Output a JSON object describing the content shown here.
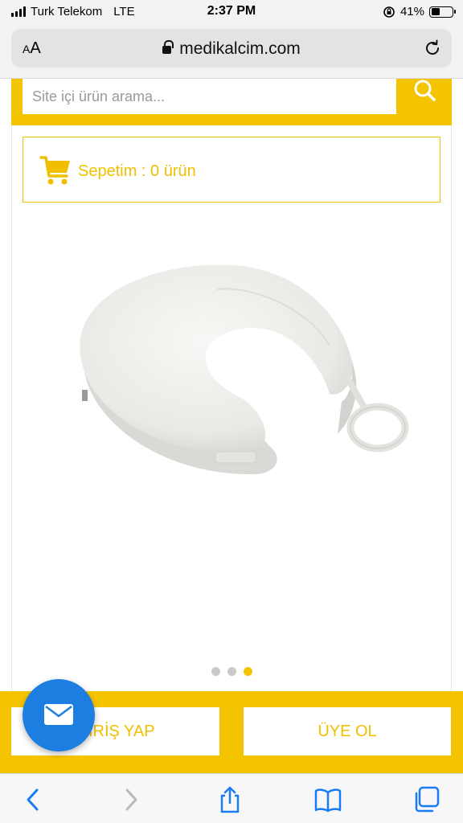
{
  "status_bar": {
    "carrier": "Turk Telekom",
    "network": "LTE",
    "time": "2:37 PM",
    "battery": "41%",
    "battery_level": 0.41
  },
  "browser": {
    "text_size_label": "AA",
    "url": "medikalcim.com"
  },
  "search": {
    "placeholder": "Site içi ürün arama..."
  },
  "cart": {
    "label": "Sepetim : 0 ürün"
  },
  "carousel": {
    "slide_count": 3,
    "active_index": 2
  },
  "actions": {
    "login_label": "GİRİŞ YAP",
    "register_label": "ÜYE OL"
  },
  "colors": {
    "brand_yellow": "#f5c400",
    "mail_blue": "#1c7ee0"
  },
  "icons": {
    "search": "search-icon",
    "cart": "cart-icon",
    "mail": "mail-icon",
    "back": "back-icon",
    "forward": "forward-icon",
    "share": "share-icon",
    "bookmarks": "bookmarks-icon",
    "tabs": "tabs-icon"
  }
}
